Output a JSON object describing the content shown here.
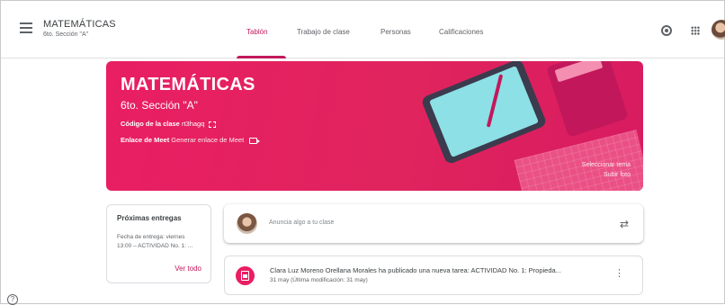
{
  "header": {
    "class_title": "MATEMÁTICAS",
    "class_subtitle": "6to. Sección \"A\"",
    "tabs": [
      {
        "label": "Tablón"
      },
      {
        "label": "Trabajo de clase"
      },
      {
        "label": "Personas"
      },
      {
        "label": "Calificaciones"
      }
    ],
    "active_tab": "Tablón",
    "icons": [
      "menu-icon",
      "gear-icon",
      "apps-grid-icon",
      "avatar"
    ]
  },
  "banner": {
    "title": "MATEMÁTICAS",
    "subtitle": "6to. Sección \"A\"",
    "code_label": "Código de la clase",
    "code_value": "rt3hagq",
    "meet_label": "Enlace de Meet",
    "meet_link": "Generar enlace de Meet",
    "select_theme": "Seleccionar tema",
    "upload_photo": "Subir foto",
    "color": "#e91e63"
  },
  "upcoming": {
    "title": "Próximas entregas",
    "line1": "Fecha de entrega: viernes",
    "line2": "13:00 – ACTIVIDAD No. 1: ...",
    "view_all": "Ver todo"
  },
  "announce": {
    "placeholder": "Anuncia algo a tu clase"
  },
  "post": {
    "title": "Clara Luz Moreno Orellana Morales ha publicado una nueva tarea: ACTIVIDAD No. 1: Propieda...",
    "date": "31 may (Última modificación: 31 may)"
  },
  "colors": {
    "accent": "#c2185b",
    "banner": "#e91e63"
  }
}
